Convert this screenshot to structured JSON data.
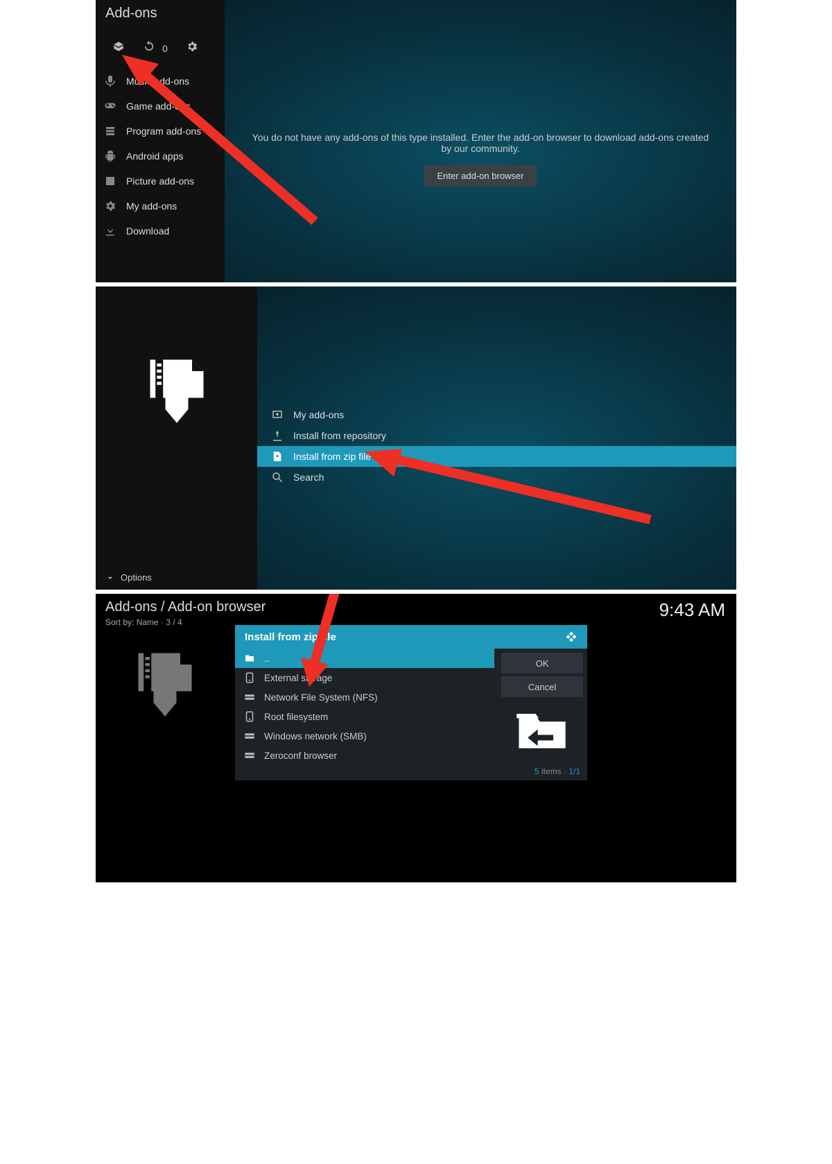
{
  "clock": "9:43 AM",
  "p1": {
    "title": "Add-ons",
    "count": "0",
    "menu": [
      "Music add-ons",
      "Game add-ons",
      "Program add-ons",
      "Android apps",
      "Picture add-ons",
      "My add-ons",
      "Download"
    ],
    "msg": "You do not have any add-ons of this type installed. Enter the add-on browser to download add-ons created by our community.",
    "btn": "Enter add-on browser"
  },
  "p2": {
    "title": "Add-ons / Add-on browser",
    "sub": "Sort by: Name  ·  3 / 4",
    "options": "Options",
    "menu": [
      "My add-ons",
      "Install from repository",
      "Install from zip file",
      "Search"
    ]
  },
  "p3": {
    "title": "Add-ons / Add-on browser",
    "sub": "Sort by: Name  ·  3 / 4",
    "dlg_title": "Install from zip file",
    "ok": "OK",
    "cancel": "Cancel",
    "items": [
      "..",
      "External storage",
      "Network File System (NFS)",
      "Root filesystem",
      "Windows network (SMB)",
      "Zeroconf browser"
    ],
    "foot_n": "5",
    "foot_lbl": " items · ",
    "foot_pg": "1/1"
  }
}
